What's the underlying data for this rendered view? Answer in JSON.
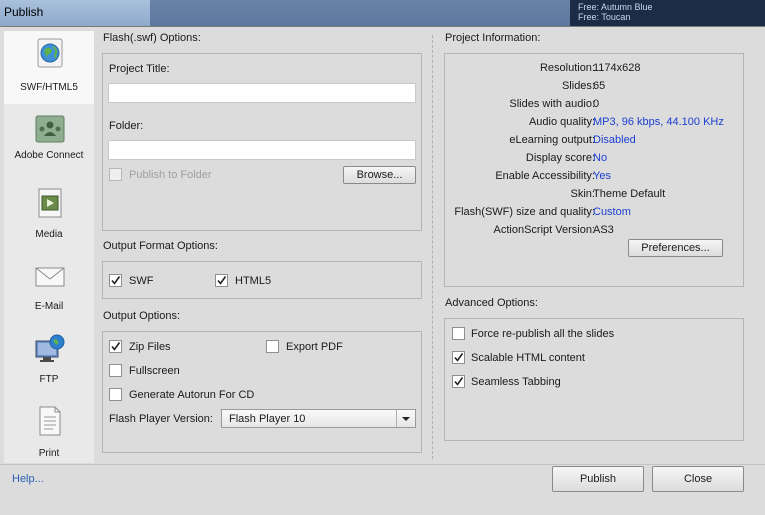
{
  "window": {
    "title": "Publish",
    "bg_text_1": "Free: Autumn Blue",
    "bg_text_2": "Free: Toucan"
  },
  "sidebar": {
    "items": [
      {
        "label": "SWF/HTML5",
        "icon": "globe-document-icon"
      },
      {
        "label": "Adobe Connect",
        "icon": "adobe-connect-icon"
      },
      {
        "label": "Media",
        "icon": "film-document-icon"
      },
      {
        "label": "E-Mail",
        "icon": "envelope-icon"
      },
      {
        "label": "FTP",
        "icon": "computer-globe-icon"
      },
      {
        "label": "Print",
        "icon": "document-icon"
      }
    ]
  },
  "flash_options": {
    "section_title": "Flash(.swf) Options:",
    "project_title_label": "Project Title:",
    "project_title_value": "",
    "folder_label": "Folder:",
    "folder_value": "",
    "publish_to_folder_label": "Publish to Folder",
    "browse_label": "Browse..."
  },
  "output_format": {
    "section_title": "Output Format Options:",
    "swf_label": "SWF",
    "html5_label": "HTML5"
  },
  "output_options": {
    "section_title": "Output Options:",
    "zip_label": "Zip Files",
    "export_pdf_label": "Export PDF",
    "fullscreen_label": "Fullscreen",
    "autorun_label": "Generate Autorun For CD",
    "player_version_label": "Flash Player Version:",
    "player_version_value": "Flash Player 10"
  },
  "project_info": {
    "section_title": "Project Information:",
    "rows": [
      {
        "key": "Resolution:",
        "value": "1174x628",
        "link": false
      },
      {
        "key": "Slides:",
        "value": "65",
        "link": false
      },
      {
        "key": "Slides with audio:",
        "value": "0",
        "link": false
      },
      {
        "key": "Audio quality:",
        "value": "MP3, 96 kbps, 44.100 KHz",
        "link": true
      },
      {
        "key": "eLearning output:",
        "value": "Disabled",
        "link": true
      },
      {
        "key": "Display score:",
        "value": "No",
        "link": true
      },
      {
        "key": "Enable Accessibility:",
        "value": "Yes",
        "link": true
      },
      {
        "key": "Skin:",
        "value": "Theme Default",
        "link": false
      },
      {
        "key": "Flash(SWF) size and quality:",
        "value": "Custom",
        "link": true
      },
      {
        "key": "ActionScript Version:",
        "value": "AS3",
        "link": false
      }
    ],
    "preferences_label": "Preferences..."
  },
  "advanced_options": {
    "section_title": "Advanced Options:",
    "force_label": "Force re-publish all the slides",
    "scalable_label": "Scalable HTML content",
    "seamless_label": "Seamless Tabbing"
  },
  "footer": {
    "help_label": "Help...",
    "publish_label": "Publish",
    "close_label": "Close"
  },
  "colors": {
    "link_blue": "#1a3fd1",
    "help_blue": "#2a5fb6",
    "dialog_bg": "#dcdcdc"
  }
}
